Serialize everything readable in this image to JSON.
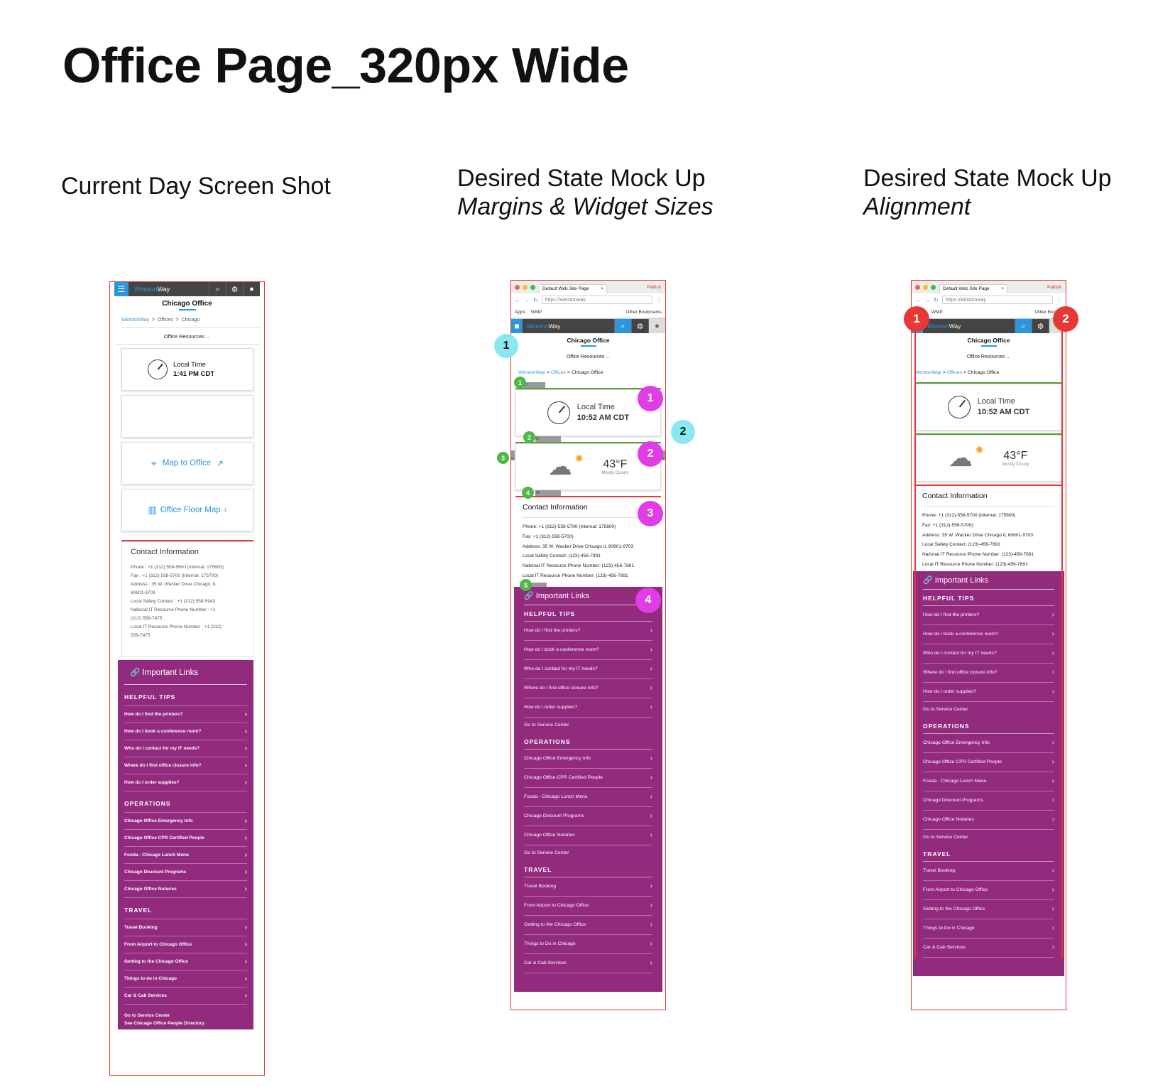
{
  "page": {
    "title": "Office Page_320px Wide",
    "col1_heading": "Current Day Screen Shot",
    "col2_heading": "Desired State Mock Up",
    "col2_sub": "Margins & Widget Sizes",
    "col3_heading": "Desired State Mock Up",
    "col3_sub": "Alignment"
  },
  "current": {
    "brand_a": "Winston",
    "brand_b": "Way",
    "page_title": "Chicago Office",
    "crumb": [
      "WinstonWay",
      "Offices",
      "Chicago"
    ],
    "crumb_sep": ">",
    "office_resources": "Office Resources",
    "local_time_label": "Local Time",
    "local_time_value": "1:41 PM CDT",
    "map_label": "Map to Office",
    "floor_label": "Office Floor Map",
    "contact_heading": "Contact Information",
    "contact_lines": [
      "Phone : +1 (312) 558-5600 (Internal: 175600)",
      "Fax : +1 (312) 558-5700 (Internal: 175700)",
      "Address : 35 W. Wacker Drive Chicago, IL",
      "60601-9703",
      "Local Safety Contact : +1 (312) 558-5943",
      "National IT Resource Phone Number : +1",
      "(312) 558-7475",
      "Local IT Resource Phone Number : +1 (312)",
      "558-7475"
    ],
    "links_heading": "Important Links",
    "sections": [
      {
        "title": "HELPFUL TIPS",
        "items": [
          "How do I find the printers?",
          "How do I book a conference room?",
          "Who do I contact for my IT needs?",
          "Where do I find office closure info?",
          "How do I order supplies?"
        ]
      },
      {
        "title": "OPERATIONS",
        "items": [
          "Chicago Office Emergency Info",
          "Chicago Office CPR Certified People",
          "Fooda - Chicago Lunch Menu",
          "Chicago Discount Programs",
          "Chicago Office Notaries"
        ]
      },
      {
        "title": "TRAVEL",
        "items": [
          "Travel Booking",
          "From Airport to Chicago Office",
          "Getting to the Chicago Office",
          "Things to do in Chicago",
          "Car & Cab Services"
        ]
      }
    ],
    "footer_lines": [
      "Go to Service Center",
      "See Chicago Office People Directory"
    ]
  },
  "mock": {
    "tab_title": "Default Web Site Page",
    "user": "Patrick",
    "url": "https://winstonway",
    "bm_apps": "Apps",
    "bm_wmp": "WMP",
    "bm_other": "Other Bookmarks",
    "bm_other_short": "Other Bookm",
    "brand_a": "Winston",
    "brand_b": "Way",
    "page_title": "Chicago Office",
    "office_resources": "Office Resources",
    "crumb_a": "WinstonWay",
    "crumb_b": "Offices",
    "crumb_c": "Chicago Office",
    "crumb_sep": ">",
    "local_time_label": "Local Time",
    "local_time_value": "10:52 AM CDT",
    "temp": "43°F",
    "condition": "Mostly Cloudy",
    "contact_heading": "Contact Information",
    "contact_lines": [
      "Phone: +1 (312)-558-5700 (Internal: 175600)",
      "Fax: +1 (312)-558-5700)",
      "Address: 35 W. Wacker Drive Chicago IL 60601-9703",
      "Local Safety Contact: (123)-456-7891",
      "National IT Resource Phone Number: (123)-456-7891",
      "Local IT Resource Phone Number: (123)-456-7891"
    ],
    "links_heading": "Important Links",
    "sections": [
      {
        "title": "HELPFUL TIPS",
        "items": [
          "How do I find the printers?",
          "How do I book a conference room?",
          "Who do I contact for my IT needs?",
          "Where do I find office closure info?",
          "How do I order supplies?"
        ],
        "footer": "Go to Service Center"
      },
      {
        "title": "OPERATIONS",
        "items": [
          "Chicago Office Emergency Info",
          "Chicago Office CPR Certified People",
          "Fooda - Chicago Lunch Menu",
          "Chicago Discount Programs",
          "Chicago Office Notaries"
        ],
        "footer": "Go to Service Center"
      },
      {
        "title": "TRAVEL",
        "items": [
          "Travel Booking",
          "From Airport to Chicago Office",
          "Getting to the Chicago Office",
          "Things to Do in Chicago",
          "Car & Cab Services"
        ]
      }
    ],
    "spacing_labels": [
      "17",
      "12",
      "9",
      "9",
      "24",
      "10"
    ]
  },
  "annotations": {
    "cyan": [
      "1",
      "2"
    ],
    "magenta": [
      "1",
      "2",
      "3",
      "4"
    ],
    "green": [
      "1",
      "2",
      "3",
      "4",
      "5"
    ],
    "red": [
      "1",
      "2"
    ]
  },
  "colors": {
    "accent_blue": "#2c95dd",
    "purple": "#922a7d",
    "frame_red": "#e53935",
    "guide_green": "#5c9e3a",
    "badge_cyan": "#8ce8f0",
    "badge_magenta": "#e23ce6"
  }
}
